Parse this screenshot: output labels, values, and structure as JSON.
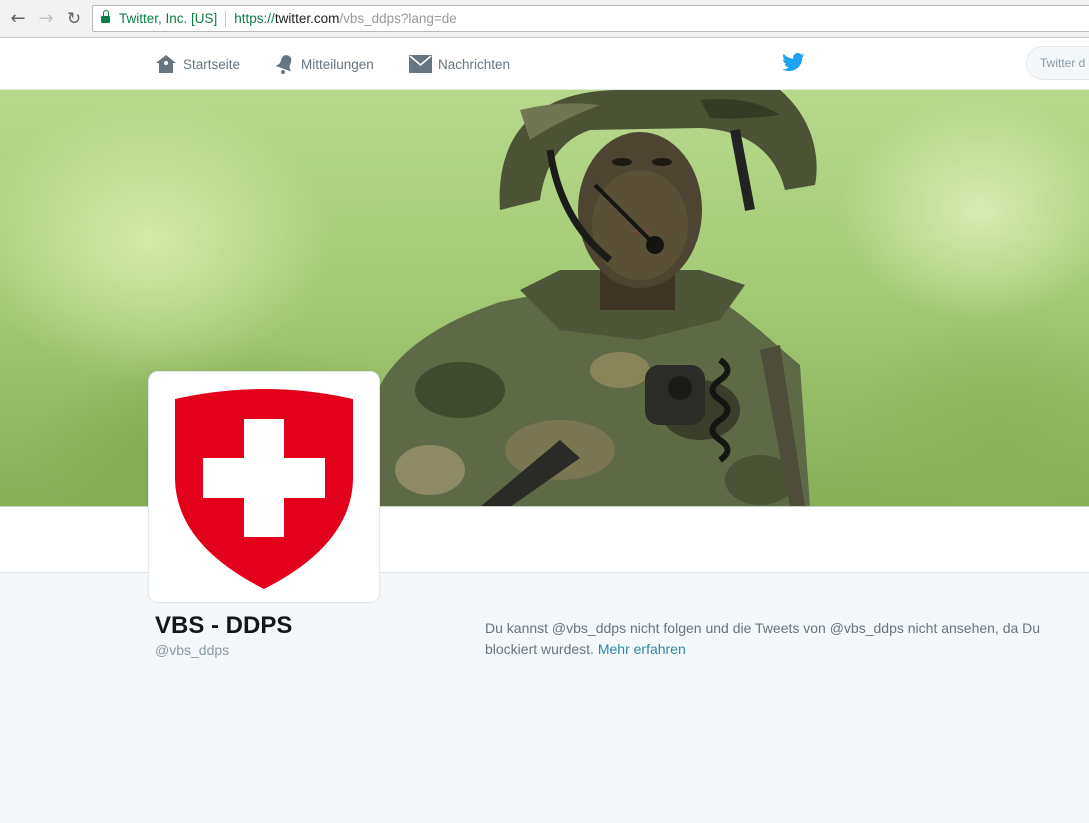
{
  "browser": {
    "ev_name": "Twitter, Inc. [US]",
    "url_scheme": "https://",
    "url_host": "twitter.com",
    "url_path": "/vbs_ddps?lang=de"
  },
  "nav": {
    "home_label": "Startseite",
    "notifications_label": "Mitteilungen",
    "messages_label": "Nachrichten",
    "search_placeholder": "Twitter d"
  },
  "profile": {
    "display_name": "VBS - DDPS",
    "screen_name": "@vbs_ddps"
  },
  "blocked": {
    "message": "Du kannst @vbs_ddps nicht folgen und die Tweets von @vbs_ddps nicht ansehen, da Du blockiert wurdest.",
    "link_label": "Mehr erfahren"
  },
  "colors": {
    "accent": "#1da1f2",
    "swiss_red": "#e2001a",
    "ev_green": "#0b8043"
  },
  "icons": [
    "back-icon",
    "forward-icon",
    "reload-icon",
    "lock-icon",
    "home-icon",
    "bell-icon",
    "envelope-icon",
    "twitter-bird-icon",
    "swiss-coat-of-arms"
  ]
}
